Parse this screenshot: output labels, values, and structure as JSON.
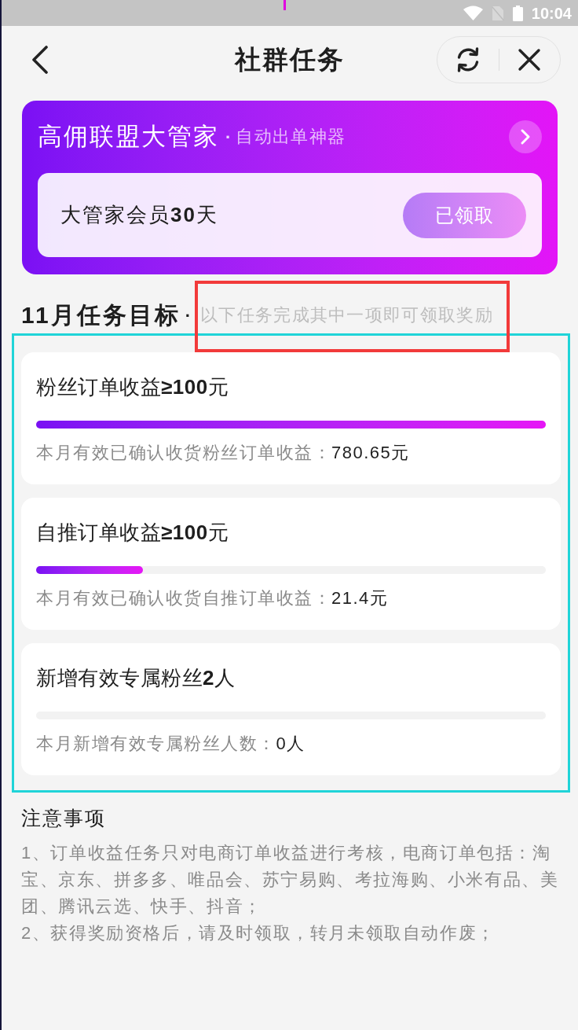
{
  "status_bar": {
    "time": "10:04"
  },
  "header": {
    "title": "社群任务"
  },
  "banner": {
    "title": "高佣联盟大管家",
    "separator": "·",
    "tagline": "自动出单神器",
    "reward": "大管家会员**30**天",
    "button": {
      "label": "已领取",
      "claimed": true
    }
  },
  "section": {
    "title": "11月任务目标",
    "separator": "·",
    "note": "以下任务完成其中一项即可领取奖励",
    "note_framed": true,
    "tasks_framed": true
  },
  "tasks": [
    {
      "title": "粉丝订单收益**≥100**元",
      "level": 1,
      "caption": "本月有效已确认收货粉丝订单收益：",
      "value": "780.65元"
    },
    {
      "title": "自推订单收益**≥100**元",
      "level": 0.21,
      "caption": "本月有效已确认收货自推订单收益：",
      "value": "21.4元"
    },
    {
      "title": "新增有效专属粉丝**2**人",
      "caption": "本月新增有效专属粉丝人数：",
      "value": "0人"
    }
  ],
  "notes": {
    "title": "注意事项",
    "items": [
      "1、订单收益任务只对电商订单收益进行考核，电商订单包括：淘宝、京东、拼多多、唯品会、苏宁易购、考拉海购、小米有品、美团、腾讯云选、快手、抖音；",
      "2、获得奖励资格后，请及时领取，转月未领取自动作废；"
    ]
  }
}
